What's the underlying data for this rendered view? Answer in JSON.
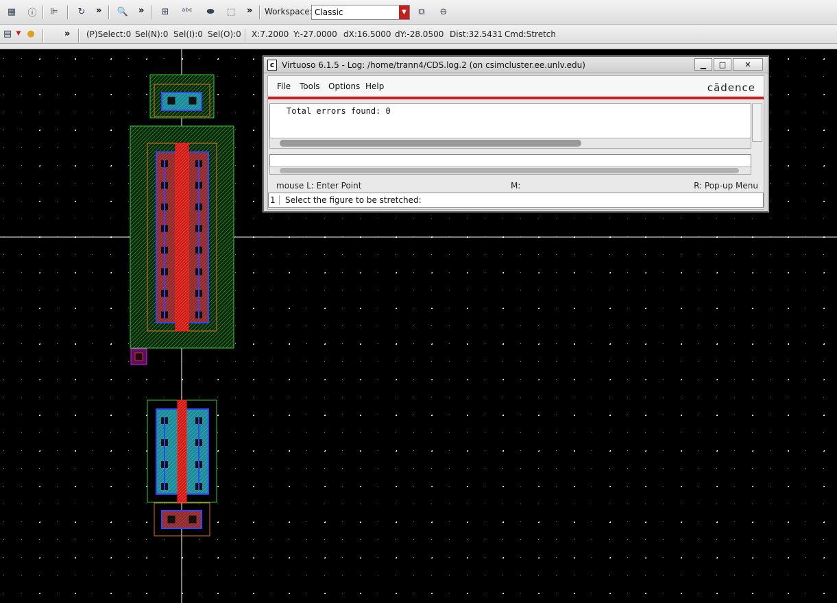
{
  "toolbar": {
    "workspace_label": "Workspace:",
    "workspace_value": "Classic",
    "overflow_glyph": "»"
  },
  "status": {
    "psel": "(P)Select:0",
    "seln": "Sel(N):0",
    "seli": "Sel(I):0",
    "selo": "Sel(O):0",
    "x": "X:7.2000",
    "y": "Y:-27.0000",
    "dx": "dX:16.5000",
    "dy": "dY:-28.0500",
    "dist": "Dist:32.5431",
    "cmd": "Cmd:Stretch"
  },
  "log_window": {
    "title": "Virtuoso 6.1.5 - Log: /home/trann4/CDS.log.2 (on csimcluster.ee.unlv.edu)",
    "icon_letter": "c",
    "menu": [
      "File",
      "Tools",
      "Options",
      "Help"
    ],
    "brand": "cādence",
    "log_line": "Total errors found: 0",
    "mouse_left": "mouse L: Enter Point",
    "mouse_mid": "M:",
    "mouse_right": "R: Pop-up Menu",
    "prompt_number": "1",
    "prompt_text": "Select the figure to be stretched:"
  },
  "colors": {
    "canvas_bg": "#000000",
    "nwell": "#33cc33",
    "implant": "#e07020",
    "poly": "#ee2020",
    "metal1": "#3344ff",
    "active": "#2aa8b0",
    "contact": "#111111",
    "title_red": "#c81e1e"
  }
}
